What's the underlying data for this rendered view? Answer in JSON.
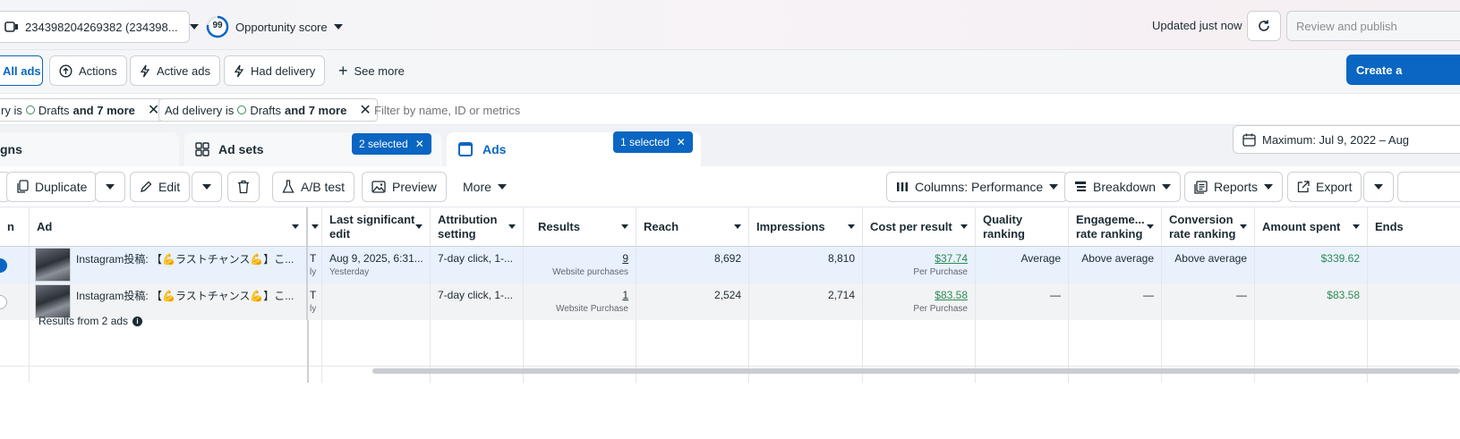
{
  "topbar": {
    "account_label": "234398204269382 (234398...",
    "opportunity_score": "99",
    "opportunity_label": "Opportunity score",
    "updated": "Updated just now",
    "review_publish": "Review and publish"
  },
  "nav": {
    "all_ads": "All ads",
    "actions": "Actions",
    "active_ads": "Active ads",
    "had_delivery": "Had delivery",
    "see_more": "See more",
    "create": "Create a"
  },
  "filters": {
    "chip1_prefix": "ry is",
    "chip1_value": "Drafts",
    "chip1_more": "and 7 more",
    "chip2_prefix": "Ad delivery is",
    "chip2_value": "Drafts",
    "chip2_more": "and 7 more",
    "search_placeholder": "Filter by name, ID or metrics"
  },
  "tabs": {
    "campaigns": "gns",
    "adsets": "Ad sets",
    "adsets_badge": "2 selected",
    "ads": "Ads",
    "ads_badge": "1 selected",
    "date_range": "Maximum: Jul 9, 2022 – Aug"
  },
  "toolbar": {
    "duplicate": "Duplicate",
    "edit": "Edit",
    "ab_test": "A/B test",
    "preview": "Preview",
    "more": "More",
    "columns": "Columns: Performance",
    "breakdown": "Breakdown",
    "reports": "Reports",
    "export": "Export"
  },
  "columns": {
    "col0": "n",
    "ad": "Ad",
    "last_edit": "Last significant edit",
    "attribution": "Attribution setting",
    "results": "Results",
    "reach": "Reach",
    "impressions": "Impressions",
    "cost_per_result": "Cost per result",
    "quality": "Quality ranking",
    "engagement": "Engageme... rate ranking",
    "conversion": "Conversion rate ranking",
    "amount_spent": "Amount spent",
    "ends": "Ends"
  },
  "rows": [
    {
      "ad_name": "Instagram投稿: 【💪ラストチャンス💪】こ...",
      "t_col": "T",
      "t_sub": "ly",
      "last_edit": "Aug 9, 2025, 6:31...",
      "last_edit_sub": "Yesterday",
      "attribution": "7-day click, 1-...",
      "results": "9",
      "results_sub": "Website purchases",
      "reach": "8,692",
      "impressions": "8,810",
      "cost": "$37.74",
      "cost_sub": "Per Purchase",
      "quality": "Average",
      "engagement": "Above average",
      "conversion": "Above average",
      "spent": "$339.62"
    },
    {
      "ad_name": "Instagram投稿: 【💪ラストチャンス💪】こ...",
      "t_col": "T",
      "t_sub": "ly",
      "last_edit": "",
      "last_edit_sub": "",
      "attribution": "7-day click, 1-...",
      "results": "1",
      "results_sub": "Website Purchase",
      "reach": "2,524",
      "impressions": "2,714",
      "cost": "$83.58",
      "cost_sub": "Per Purchase",
      "quality": "—",
      "engagement": "—",
      "conversion": "—",
      "spent": "$83.58"
    }
  ],
  "summary": {
    "results_from": "Results from 2 ads"
  },
  "colors": {
    "accent": "#0a66c2",
    "money": "#2e8a57",
    "selected_row": "#e8f1fc"
  }
}
